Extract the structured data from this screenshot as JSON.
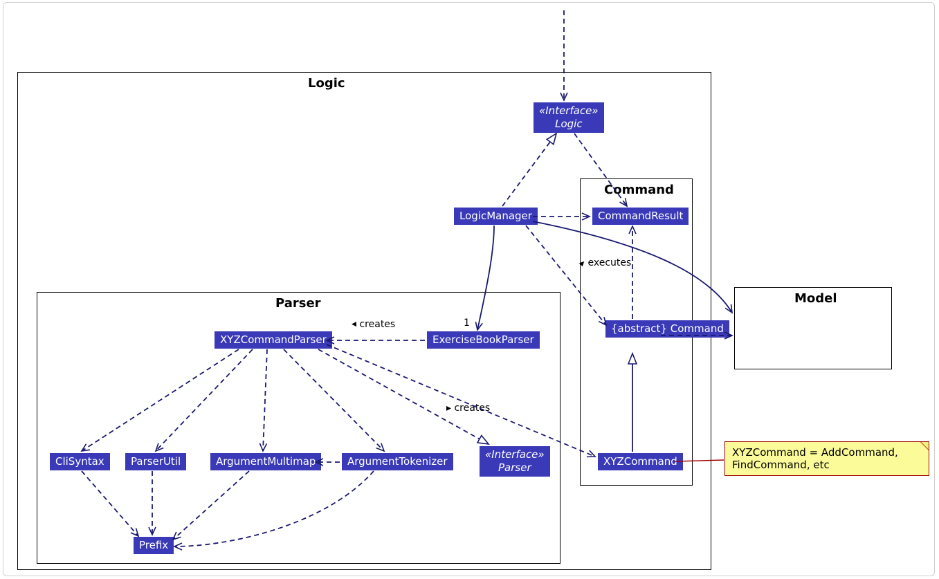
{
  "packages": {
    "logic_title": "Logic",
    "parser_title": "Parser",
    "command_title": "Command",
    "model_title": "Model"
  },
  "classes": {
    "logic_iface_stereo": "«Interface»",
    "logic_iface_name": "Logic",
    "logic_manager": "LogicManager",
    "command_result": "CommandResult",
    "abstract_command_stereo": "{abstract}",
    "abstract_command_name": "Command",
    "xyz_command": "XYZCommand",
    "exercise_book_parser": "ExerciseBookParser",
    "xyz_command_parser": "XYZCommandParser",
    "parser_iface_stereo": "«Interface»",
    "parser_iface_name": "Parser",
    "cli_syntax": "CliSyntax",
    "parser_util": "ParserUtil",
    "argument_multimap": "ArgumentMultimap",
    "argument_tokenizer": "ArgumentTokenizer",
    "prefix": "Prefix"
  },
  "labels": {
    "mult_one": "1",
    "creates1": "creates",
    "creates2": "creates",
    "executes": "executes"
  },
  "note": {
    "text": "XYZCommand = AddCommand, FindCommand, etc"
  },
  "colors": {
    "class_fill": "#3a3ab8",
    "note_fill": "#fbfb9a",
    "note_border": "#a00000",
    "line": "#18186f"
  }
}
